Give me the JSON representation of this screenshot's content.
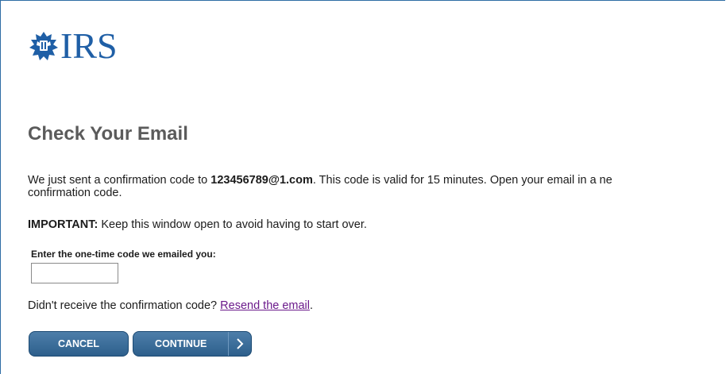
{
  "logo": {
    "text": "IRS",
    "emblem": "irs-eagle-emblem-icon"
  },
  "page": {
    "title": "Check Your Email"
  },
  "message": {
    "part1": "We just sent a confirmation code to ",
    "email": "123456789@1.com",
    "part2": ". This code is valid for 15 minutes. Open your email in a ne",
    "line2": "confirmation code."
  },
  "important": {
    "label": "IMPORTANT:",
    "text": " Keep this window open to avoid having to start over."
  },
  "code_field": {
    "label": "Enter the one-time code we emailed you:",
    "value": ""
  },
  "resend": {
    "text": "Didn't receive the confirmation code? ",
    "link": "Resend the email",
    "suffix": "."
  },
  "buttons": {
    "cancel": "CANCEL",
    "continue": "CONTINUE",
    "continue_icon": "chevron-right-icon"
  },
  "colors": {
    "brand": "#1f5fa6",
    "button": "#3a6b98",
    "link": "#6b1a8b",
    "heading": "#5b5b5b"
  }
}
